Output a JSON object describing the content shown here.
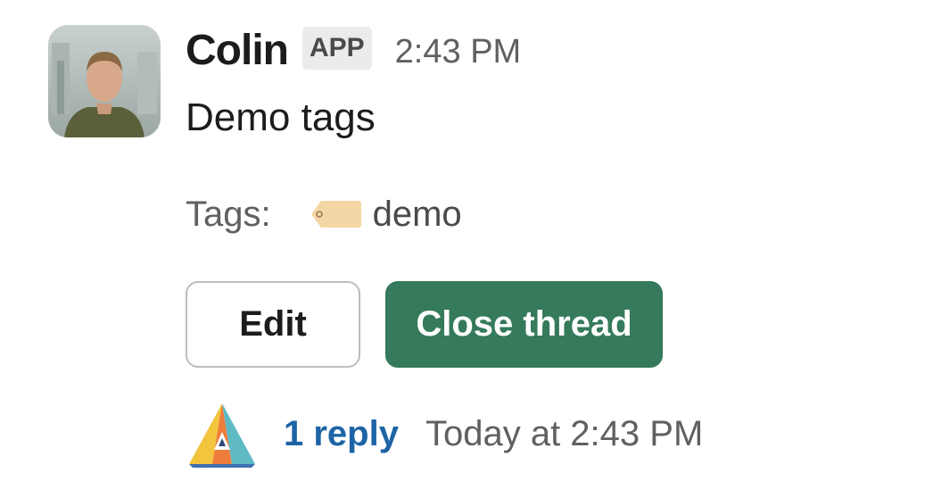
{
  "message": {
    "author": "Colin",
    "badge": "APP",
    "time": "2:43 PM",
    "text": "Demo tags"
  },
  "tags": {
    "label": "Tags:",
    "items": [
      {
        "name": "demo",
        "icon": "tag-icon",
        "color": "#f3d6a4"
      }
    ]
  },
  "actions": {
    "edit_label": "Edit",
    "close_label": "Close thread",
    "close_color": "#357a5b"
  },
  "thread": {
    "reply_count": "1 reply",
    "last_reply": "Today at 2:43 PM",
    "link_color": "#1d64a6"
  }
}
